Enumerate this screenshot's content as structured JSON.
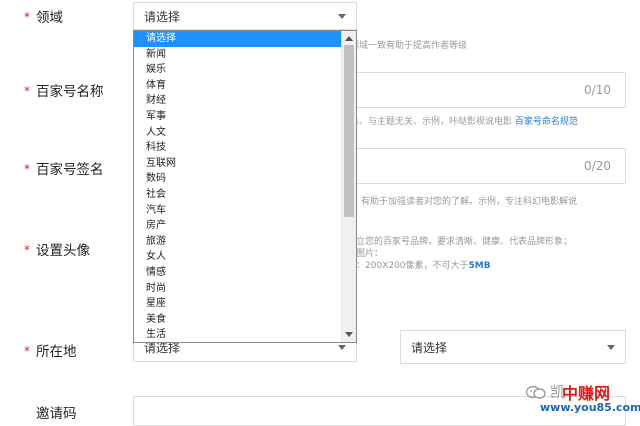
{
  "form": {
    "domain": {
      "required": "*",
      "label": "领域",
      "value": "请选择",
      "hint": "领域一致有助于提高作者等级"
    },
    "account_name": {
      "required": "*",
      "label": "百家号名称",
      "counter": "0/10",
      "hint_prefix": "不能出现营销、无关信息、与主题无关、示例，咔哒影视说电影",
      "hint_link": "百家号命名规范"
    },
    "signature": {
      "required": "*",
      "label": "百家号签名",
      "counter": "0/20",
      "hint": "，有助于加强读者对您的了解。示例，专注科幻电影解说"
    },
    "avatar": {
      "required": "*",
      "label": "设置头像",
      "hint_line1": "立您的百家号品牌，要求清晰、健康、代表品牌形象；",
      "hint_line2": "图片：",
      "hint_line3_prefix": "：200X200像素，不可大于",
      "hint_line3_strong": "5MB"
    },
    "location": {
      "required": "*",
      "label": "所在地",
      "province": "请选择",
      "city": "请选择"
    },
    "invite": {
      "label": "邀请码"
    }
  },
  "dropdown": {
    "options": [
      "请选择",
      "新闻",
      "娱乐",
      "体育",
      "财经",
      "军事",
      "人文",
      "科技",
      "互联网",
      "数码",
      "社会",
      "汽车",
      "房产",
      "旅游",
      "女人",
      "情感",
      "时尚",
      "星座",
      "美食",
      "生活"
    ],
    "selected_index": 0
  },
  "watermark": {
    "wechat_text": "凯",
    "brand_text": "中赚网",
    "domain_text": "www.you85.com"
  },
  "colors": {
    "required": "#e02020",
    "selected_bg": "#1e90ff",
    "link": "#2a7ad2",
    "brand_red": "#e21a1a",
    "domain_blue": "#1d63b8"
  }
}
